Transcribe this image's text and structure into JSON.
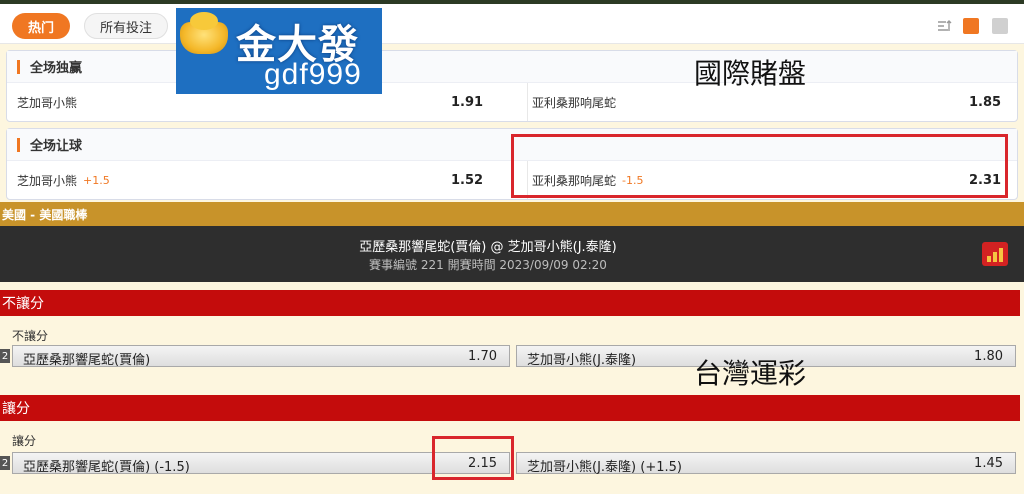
{
  "tabs": {
    "hot": "热门",
    "all_bets": "所有投注"
  },
  "toolbar": {
    "icons": [
      "sort-icon",
      "layout-single-icon",
      "layout-double-icon"
    ],
    "accent": "#f07722"
  },
  "markets": [
    {
      "title": "全场独赢",
      "left": {
        "team": "芝加哥小熊",
        "handicap": "",
        "odds": "1.91"
      },
      "right": {
        "team": "亚利桑那响尾蛇",
        "handicap": "",
        "odds": "1.85"
      }
    },
    {
      "title": "全场让球",
      "left": {
        "team": "芝加哥小熊",
        "handicap": "+1.5",
        "odds": "1.52"
      },
      "right": {
        "team": "亚利桑那响尾蛇",
        "handicap": "-1.5",
        "odds": "2.31"
      }
    }
  ],
  "logo": {
    "main": "金大發",
    "sub": "gdf999"
  },
  "captions": {
    "international": "國際賭盤",
    "taiwan": "台灣運彩"
  },
  "league": "美國 - 美國職棒",
  "match": {
    "teams": "亞歷桑那響尾蛇(賈倫) @ 芝加哥小熊(J.泰隆)",
    "info": "賽事編號 221 開賽時間 2023/09/09 02:20"
  },
  "sections": [
    {
      "title": "不讓分",
      "sub_label": "不讓分",
      "num": "2",
      "left": {
        "label": "亞歷桑那響尾蛇(賈倫)",
        "odds": "1.70"
      },
      "right": {
        "label": "芝加哥小熊(J.泰隆)",
        "odds": "1.80"
      }
    },
    {
      "title": "讓分",
      "sub_label": "讓分",
      "num": "2",
      "left": {
        "label": "亞歷桑那響尾蛇(賈倫) (-1.5)",
        "odds": "2.15"
      },
      "right": {
        "label": "芝加哥小熊(J.泰隆) (+1.5)",
        "odds": "1.45"
      }
    }
  ],
  "colors": {
    "league_bar": "#c8932a",
    "section_bar": "#c40c0c",
    "highlight_box": "#d9262c"
  }
}
